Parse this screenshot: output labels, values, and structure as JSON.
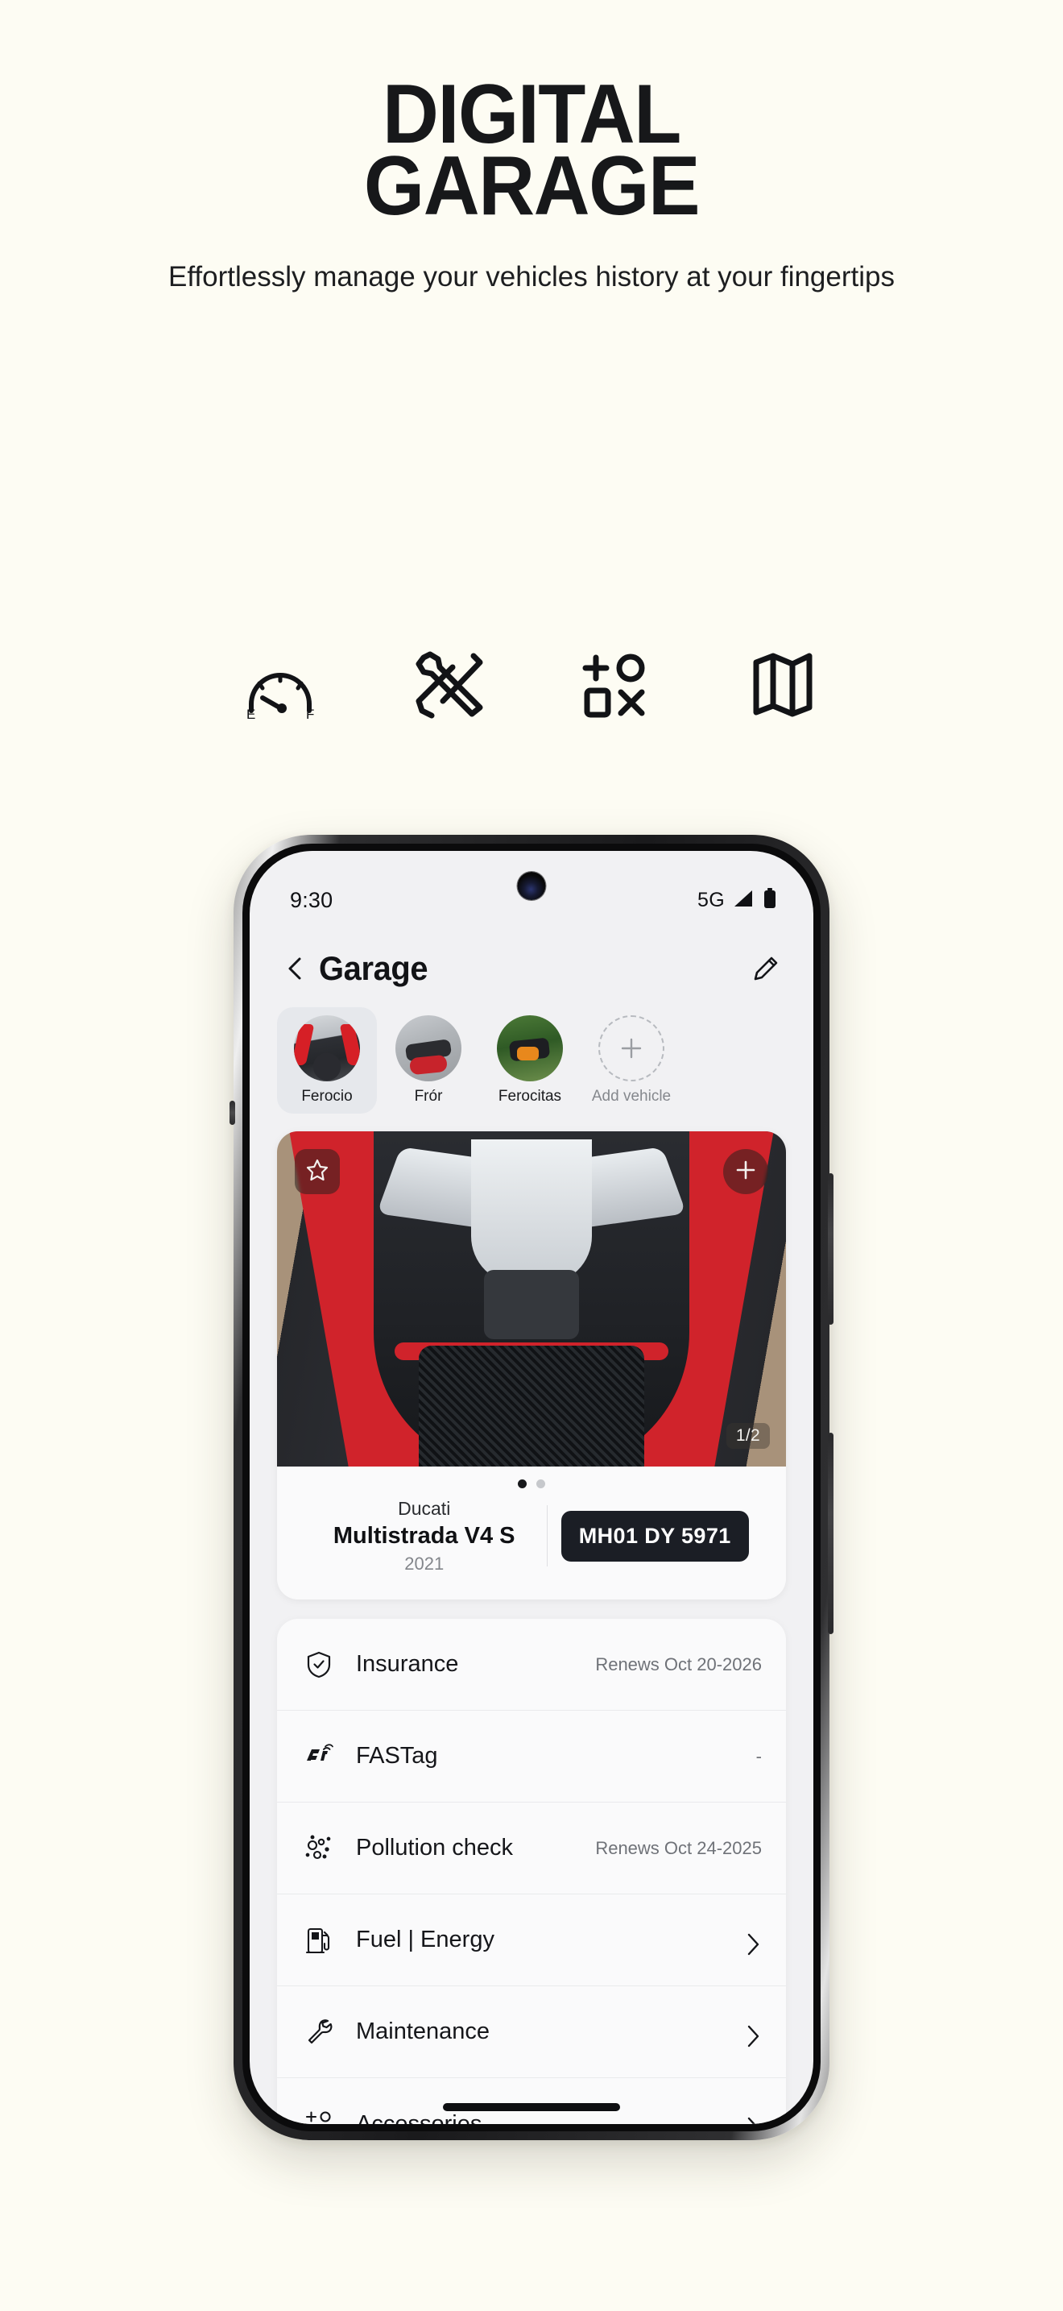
{
  "marketing": {
    "title_line1": "DIGITAL",
    "title_line2": "GARAGE",
    "subtitle": "Effortlessly manage your vehicles history at your fingertips",
    "features": [
      {
        "name": "fuel-gauge-icon",
        "label_left": "E",
        "label_right": "F"
      },
      {
        "name": "tools-icon"
      },
      {
        "name": "accessories-icon"
      },
      {
        "name": "map-icon"
      }
    ]
  },
  "phone": {
    "status_bar": {
      "time": "9:30",
      "network": "5G",
      "signal_icon": "signal-bars-icon",
      "battery_icon": "battery-full-icon"
    },
    "header": {
      "back_icon": "chevron-left-icon",
      "title": "Garage",
      "edit_icon": "pencil-edit-icon"
    },
    "vehicle_chips": [
      {
        "label": "Ferocio",
        "selected": true
      },
      {
        "label": "Frór",
        "selected": false
      },
      {
        "label": "Ferocitas",
        "selected": false
      },
      {
        "label": "Add vehicle",
        "selected": false,
        "is_add": true
      }
    ],
    "vehicle_card": {
      "favorite_icon": "star-outline-icon",
      "add_photo_icon": "plus-icon",
      "photo_count": "1/2",
      "carousel_dots": 2,
      "carousel_active_index": 0,
      "make": "Ducati",
      "model": "Multistrada V4 S",
      "year": "2021",
      "plate": "MH01 DY 5971"
    },
    "service_rows": [
      {
        "icon": "shield-check-icon",
        "label": "Insurance",
        "value": "Renews Oct 20-2026",
        "chevron": false
      },
      {
        "icon": "fastag-icon",
        "label": "FASTag",
        "value": "-",
        "chevron": false
      },
      {
        "icon": "pollution-icon",
        "label": "Pollution check",
        "value": "Renews Oct 24-2025",
        "chevron": false
      },
      {
        "icon": "fuel-pump-icon",
        "label": "Fuel | Energy",
        "value": "",
        "chevron": true
      },
      {
        "icon": "wrench-icon",
        "label": "Maintenance",
        "value": "",
        "chevron": true
      },
      {
        "icon": "accessories-icon",
        "label": "Accessories",
        "value": "",
        "chevron": true
      }
    ]
  },
  "colors": {
    "page_background": "#FDFCF3",
    "ink": "#17181A",
    "screen_background": "#F1F1F3",
    "card_background": "#FAFAFB",
    "plate_background": "#1B1E25",
    "accent_red": "#D0232B",
    "muted_text": "#6F7278"
  }
}
